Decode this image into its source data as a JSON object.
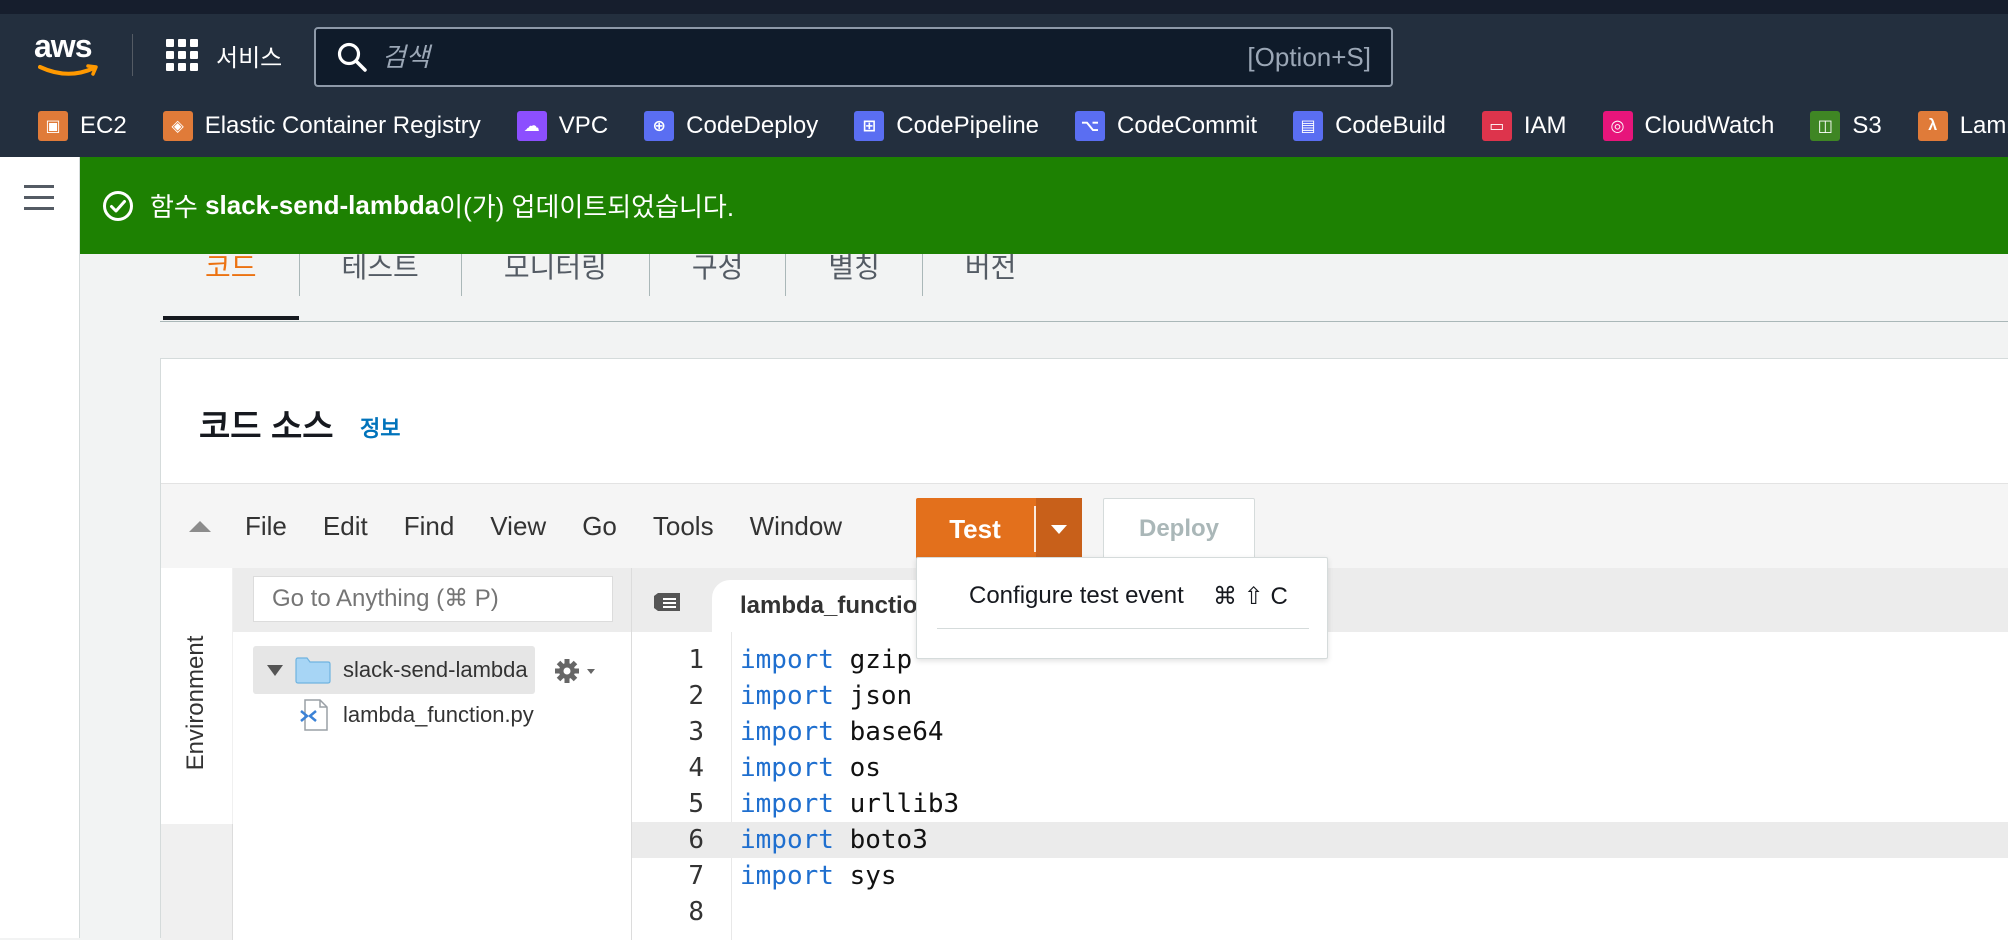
{
  "topbar": {
    "logo_text": "aws",
    "services_label": "서비스",
    "search_placeholder": "검색",
    "search_shortcut": "[Option+S]",
    "favorites": [
      {
        "label": "EC2",
        "icon": "ec2-icon",
        "color": "#e07b39"
      },
      {
        "label": "Elastic Container Registry",
        "icon": "ecr-icon",
        "color": "#e07b39"
      },
      {
        "label": "VPC",
        "icon": "vpc-icon",
        "color": "#8c4fff"
      },
      {
        "label": "CodeDeploy",
        "icon": "codedeploy-icon",
        "color": "#5a6ef2"
      },
      {
        "label": "CodePipeline",
        "icon": "codepipeline-icon",
        "color": "#5a6ef2"
      },
      {
        "label": "CodeCommit",
        "icon": "codecommit-icon",
        "color": "#5a6ef2"
      },
      {
        "label": "CodeBuild",
        "icon": "codebuild-icon",
        "color": "#5a6ef2"
      },
      {
        "label": "IAM",
        "icon": "iam-icon",
        "color": "#dd344c"
      },
      {
        "label": "CloudWatch",
        "icon": "cloudwatch-icon",
        "color": "#e7157b"
      },
      {
        "label": "S3",
        "icon": "s3-icon",
        "color": "#3f8624"
      },
      {
        "label": "Lamb",
        "icon": "lambda-icon",
        "color": "#e07b39"
      }
    ]
  },
  "flash": {
    "prefix": "함수 ",
    "function_name": "slack-send-lambda",
    "suffix": "이(가) 업데이트되었습니다.",
    "color": "#1d8102"
  },
  "tabs": [
    {
      "label": "코드",
      "active": true
    },
    {
      "label": "테스트",
      "active": false
    },
    {
      "label": "모니터링",
      "active": false
    },
    {
      "label": "구성",
      "active": false
    },
    {
      "label": "별칭",
      "active": false
    },
    {
      "label": "버전",
      "active": false
    }
  ],
  "panel": {
    "title": "코드 소스",
    "info_link": "정보"
  },
  "ide": {
    "menu": [
      "File",
      "Edit",
      "Find",
      "View",
      "Go",
      "Tools",
      "Window"
    ],
    "test_label": "Test",
    "deploy_label": "Deploy",
    "dropdown": {
      "item": "Configure test event",
      "shortcut": "⌘ ⇧ C"
    },
    "goto_placeholder": "Go to Anything (⌘ P)",
    "environment_label": "Environment",
    "tree": {
      "root": "slack-send-lambda",
      "file": "lambda_function.py"
    },
    "open_tab": "lambda_function.py",
    "code_lines": [
      {
        "num": "1",
        "kw": "import",
        "rest": "gzip"
      },
      {
        "num": "2",
        "kw": "import",
        "rest": "json"
      },
      {
        "num": "3",
        "kw": "import",
        "rest": "base64"
      },
      {
        "num": "4",
        "kw": "import",
        "rest": "os"
      },
      {
        "num": "5",
        "kw": "import",
        "rest": "urllib3"
      },
      {
        "num": "6",
        "kw": "import",
        "rest": "boto3"
      },
      {
        "num": "7",
        "kw": "import",
        "rest": "sys"
      },
      {
        "num": "8",
        "kw": "",
        "rest": ""
      }
    ]
  }
}
